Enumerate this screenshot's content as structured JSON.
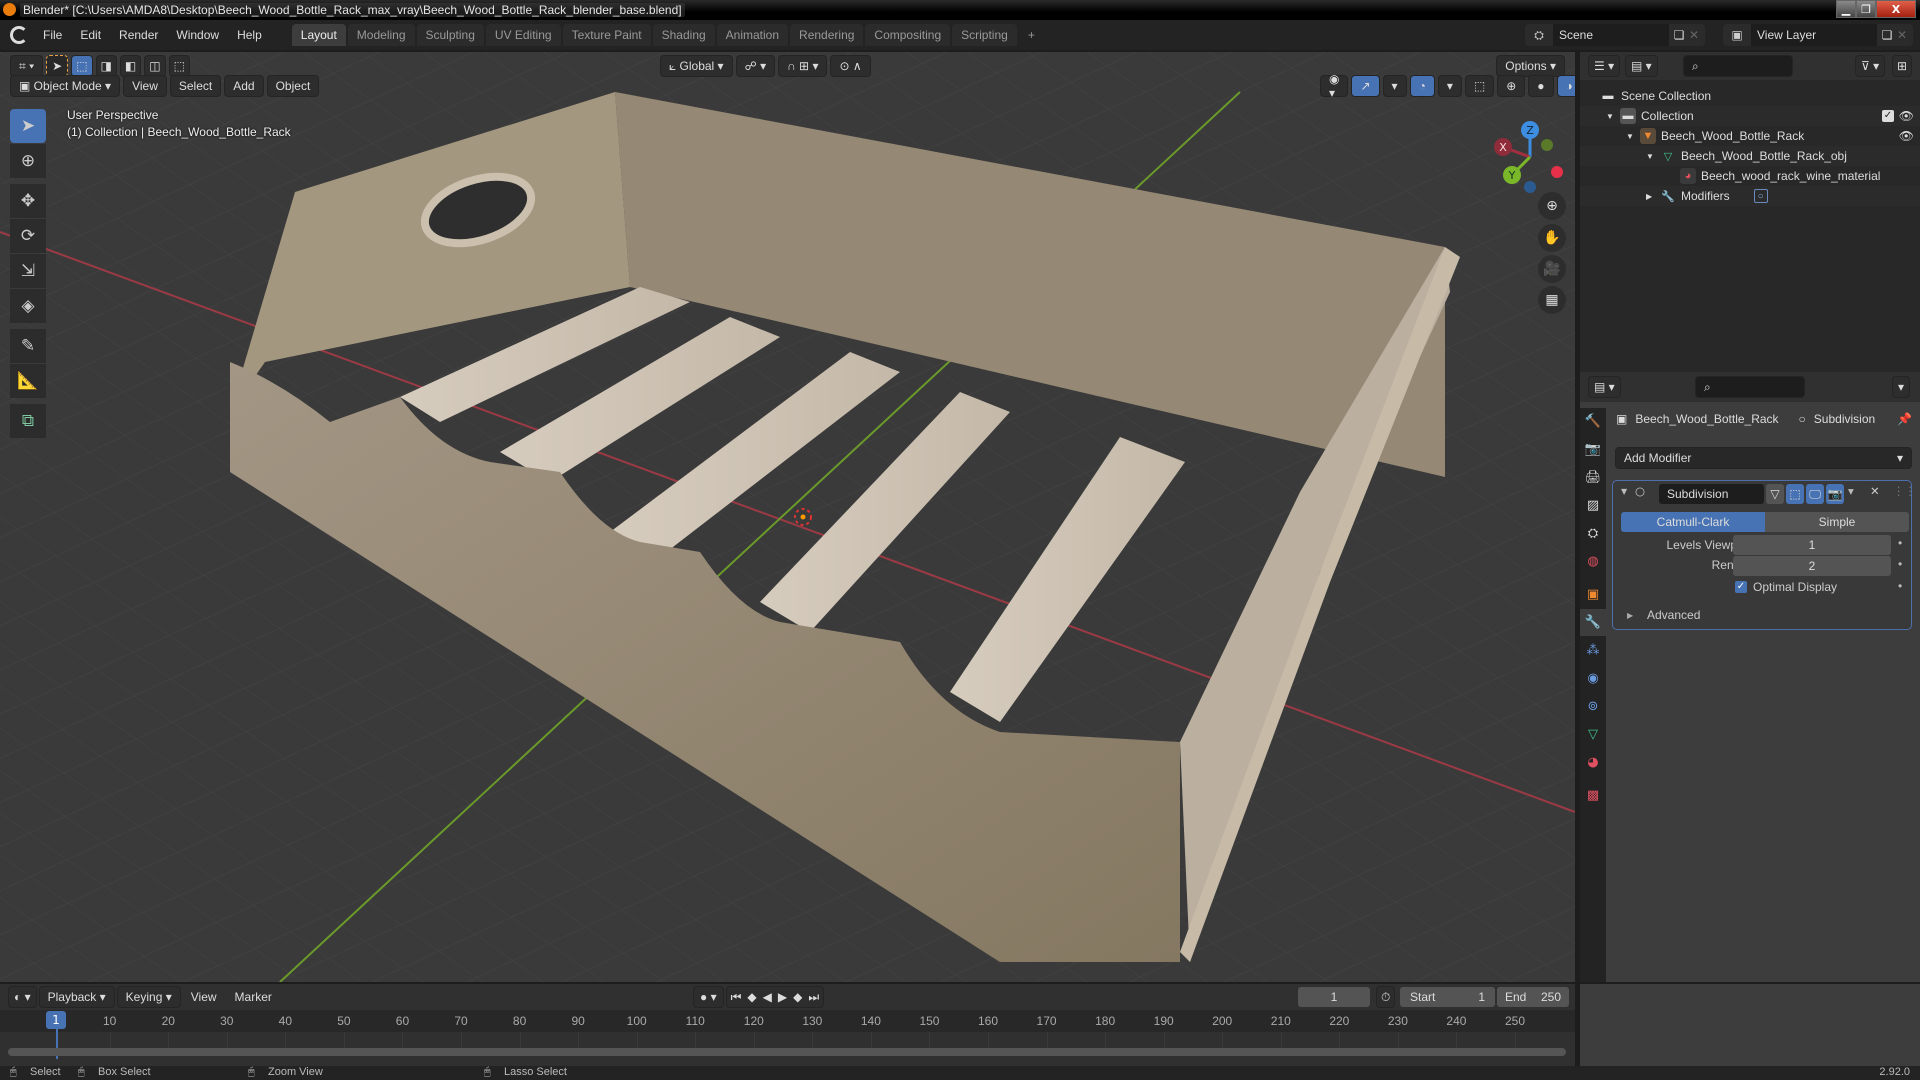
{
  "window": {
    "title": "Blender* [C:\\Users\\AMDA8\\Desktop\\Beech_Wood_Bottle_Rack_max_vray\\Beech_Wood_Bottle_Rack_blender_base.blend]",
    "min_label": "▁",
    "max_label": "❐",
    "close_label": "X"
  },
  "menubar": {
    "menus": [
      "File",
      "Edit",
      "Render",
      "Window",
      "Help"
    ],
    "workspaces": [
      "Layout",
      "Modeling",
      "Sculpting",
      "UV Editing",
      "Texture Paint",
      "Shading",
      "Animation",
      "Rendering",
      "Compositing",
      "Scripting"
    ],
    "active_workspace": "Layout",
    "add_workspace": "+",
    "scene": "Scene",
    "view_layer": "View Layer"
  },
  "viewport": {
    "header": {
      "mode": "Object Mode",
      "menus": [
        "View",
        "Select",
        "Add",
        "Object"
      ],
      "transform_orientation": "Global",
      "options_label": "Options"
    },
    "overlay_text": {
      "perspective": "User Perspective",
      "collection_info": "(1) Collection | Beech_Wood_Bottle_Rack"
    },
    "gizmo": {
      "x": "X",
      "y": "Y",
      "z": "Z"
    },
    "tools": [
      "select-box",
      "cursor",
      "move",
      "rotate",
      "scale",
      "transform",
      "annotate",
      "measure",
      "add-cube"
    ]
  },
  "outliner": {
    "search_placeholder": "",
    "items": [
      {
        "label": "Scene Collection",
        "type": "scene-collection"
      },
      {
        "label": "Collection",
        "type": "collection"
      },
      {
        "label": "Beech_Wood_Bottle_Rack",
        "type": "object"
      },
      {
        "label": "Beech_Wood_Bottle_Rack_obj",
        "type": "mesh"
      },
      {
        "label": "Beech_wood_rack_wine_material",
        "type": "material"
      },
      {
        "label": "Modifiers",
        "type": "modifiers"
      }
    ]
  },
  "properties": {
    "breadcrumb_object": "Beech_Wood_Bottle_Rack",
    "breadcrumb_modifier": "Subdivision",
    "add_modifier_label": "Add Modifier",
    "modifier": {
      "name": "Subdivision",
      "algorithms": [
        "Catmull-Clark",
        "Simple"
      ],
      "active_algorithm": "Catmull-Clark",
      "levels_viewport_label": "Levels Viewport",
      "levels_viewport": "1",
      "render_label": "Render",
      "render": "2",
      "optimal_display_label": "Optimal Display",
      "optimal_display": true,
      "advanced_label": "Advanced"
    }
  },
  "timeline": {
    "menus": [
      "Playback",
      "Keying",
      "View",
      "Marker"
    ],
    "current_frame": "1",
    "start_label": "Start",
    "start": "1",
    "end_label": "End",
    "end": "250",
    "ticks": [
      "10",
      "20",
      "30",
      "40",
      "50",
      "60",
      "70",
      "80",
      "90",
      "100",
      "110",
      "120",
      "130",
      "140",
      "150",
      "160",
      "170",
      "180",
      "190",
      "200",
      "210",
      "220",
      "230",
      "240",
      "250"
    ],
    "playhead_label": "1"
  },
  "statusbar": {
    "hints": [
      "Select",
      "Box Select",
      "Zoom View",
      "Lasso Select"
    ],
    "version": "2.92.0"
  }
}
